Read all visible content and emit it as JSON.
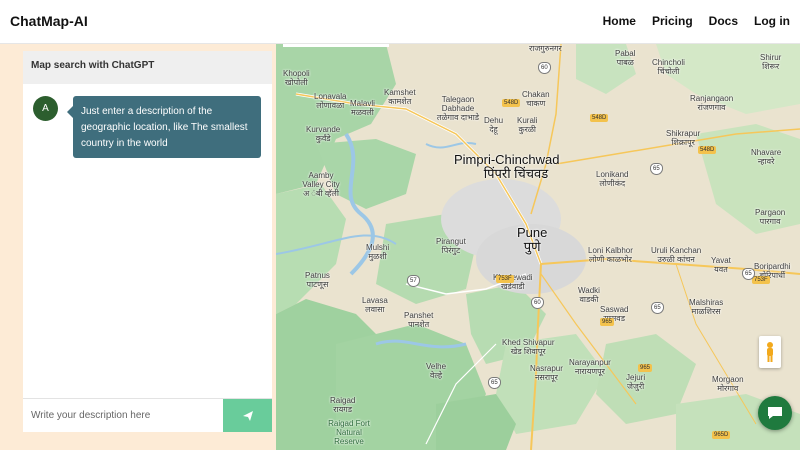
{
  "app": {
    "brand": "ChatMap-AI"
  },
  "nav": {
    "items": [
      "Home",
      "Pricing",
      "Docs",
      "Log in"
    ]
  },
  "chat": {
    "header": "Map search with ChatGPT",
    "avatar_letter": "A",
    "message": "Just enter a description of the geographic location, like The smallest country in the world",
    "input_placeholder": "Write your description here"
  },
  "map": {
    "cities": [
      {
        "name": "Pimpri-Chinchwad",
        "local": "पिंपरी चिंचवड"
      },
      {
        "name": "Pune",
        "local": "पुणे"
      }
    ],
    "places": [
      "Khopoli",
      "खोपोली",
      "Lonavala",
      "लोणावळा",
      "Malavli",
      "मळवली",
      "Kamshet",
      "कामशेत",
      "Talegaon Dabhade",
      "तळेगाव दाभाडे",
      "Chakan",
      "चाकण",
      "Dehu",
      "देहू",
      "Kurali",
      "कुरळी",
      "Pabal",
      "पाबळ",
      "Chincholi",
      "चिंचोली",
      "Shirur",
      "शिरूर",
      "Ranjangaon",
      "रांजणगाव",
      "Shikrapur",
      "शिक्रापूर",
      "Nhavare",
      "न्हावरे",
      "Kurvande",
      "कुर्वंडे",
      "Aamby Valley City",
      "अ ंबी व्हॅली",
      "Lonikand",
      "लोणीकंद",
      "Mulshi",
      "मुळशी",
      "Pirangut",
      "पिरंगुट",
      "Loni Kalbhor",
      "लोणी काळभोर",
      "Uruli Kanchan",
      "उरुळी कांचन",
      "Yavat",
      "यवत",
      "Pargaon",
      "पारगाव",
      "Boripardhi",
      "बोरिपार्धी",
      "Patnus",
      "पाटणूस",
      "Khadewadi",
      "खडेवाडी",
      "Wadki",
      "वाडकी",
      "Malshiras",
      "माळशिरस",
      "Lavasa",
      "लवासा",
      "Panshet",
      "पानशेत",
      "Saswad",
      "सासवड",
      "Khed Shivapur",
      "खेड शिवापूर",
      "Narayanpur",
      "नारायणपूर",
      "Velhe",
      "वेल्हे",
      "Nasrapur",
      "नसरापूर",
      "Jejuri",
      "जेजुरी",
      "Morgaon",
      "मोरगाव",
      "Raigad",
      "रायगड",
      "Raigad Fort Natural Reserve",
      "राजगुरुनगर"
    ],
    "road_shields": [
      "548D",
      "60",
      "548D",
      "548D",
      "753F",
      "57",
      "753F",
      "60",
      "965",
      "965",
      "965D",
      "65",
      "65",
      "65",
      "65"
    ]
  },
  "colors": {
    "accent_send": "#69cc9b",
    "bubble": "#3f6e7d",
    "avatar": "#2c5e2e",
    "fab": "#1f7a3e",
    "page_bg": "#fdebd6"
  },
  "icons": [
    "send-icon",
    "pegman-icon",
    "chat-bubble-icon"
  ]
}
